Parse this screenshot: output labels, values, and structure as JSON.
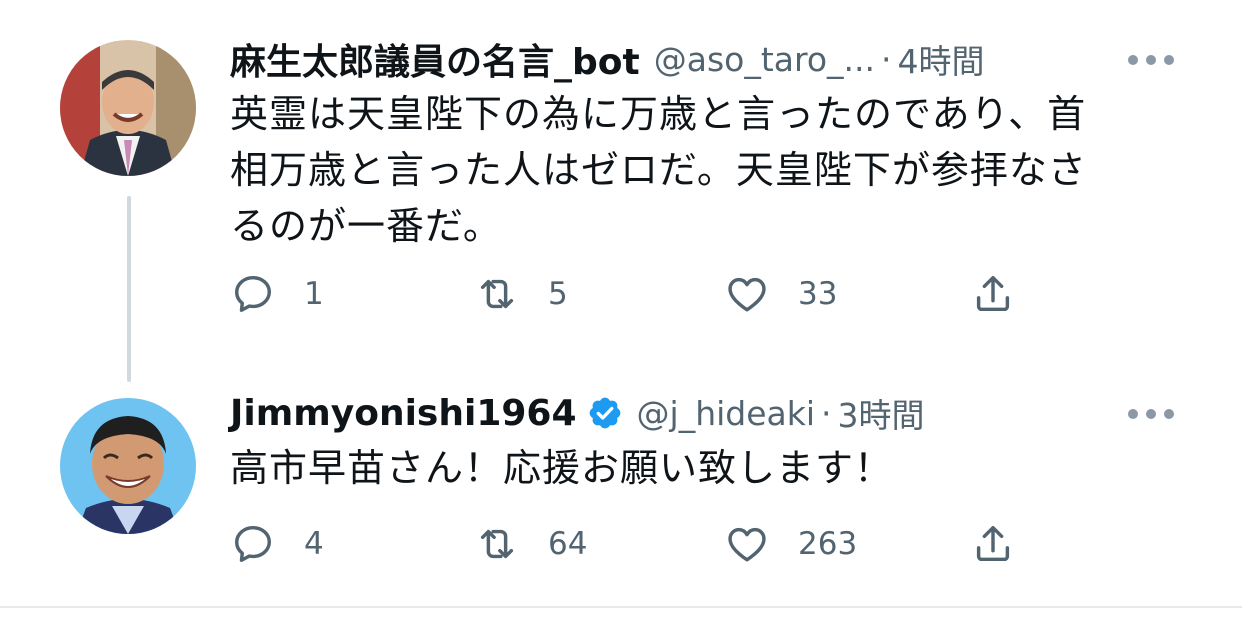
{
  "tweets": [
    {
      "display_name": "麻生太郎議員の名言_bot",
      "handle": "@aso_taro_...",
      "separator": "·",
      "time": "4時間",
      "verified": false,
      "text_lines": [
        "英霊は天皇陛下の為に万歳と言ったのであり、首",
        "相万歳と言った人はゼロだ。天皇陛下が参拝なさ",
        "るのが一番だ。"
      ],
      "replies": "1",
      "retweets": "5",
      "likes": "33",
      "avatar_icon": "avatar-photo-icon"
    },
    {
      "display_name": "Jimmyonishi1964",
      "handle": "@j_hideaki",
      "separator": "·",
      "time": "3時間",
      "verified": true,
      "text_lines": [
        "高市早苗さん！応援お願い致します！"
      ],
      "replies": "4",
      "retweets": "64",
      "likes": "263",
      "avatar_icon": "avatar-photo-icon"
    }
  ],
  "colors": {
    "text": "#0f1419",
    "secondary": "#536471",
    "verified": "#1d9bf0",
    "thread_line": "#cfd9de"
  },
  "icons": {
    "reply": "reply-icon",
    "retweet": "retweet-icon",
    "like": "like-icon",
    "share": "share-icon",
    "more": "more-icon",
    "verified": "verified-badge-icon"
  }
}
